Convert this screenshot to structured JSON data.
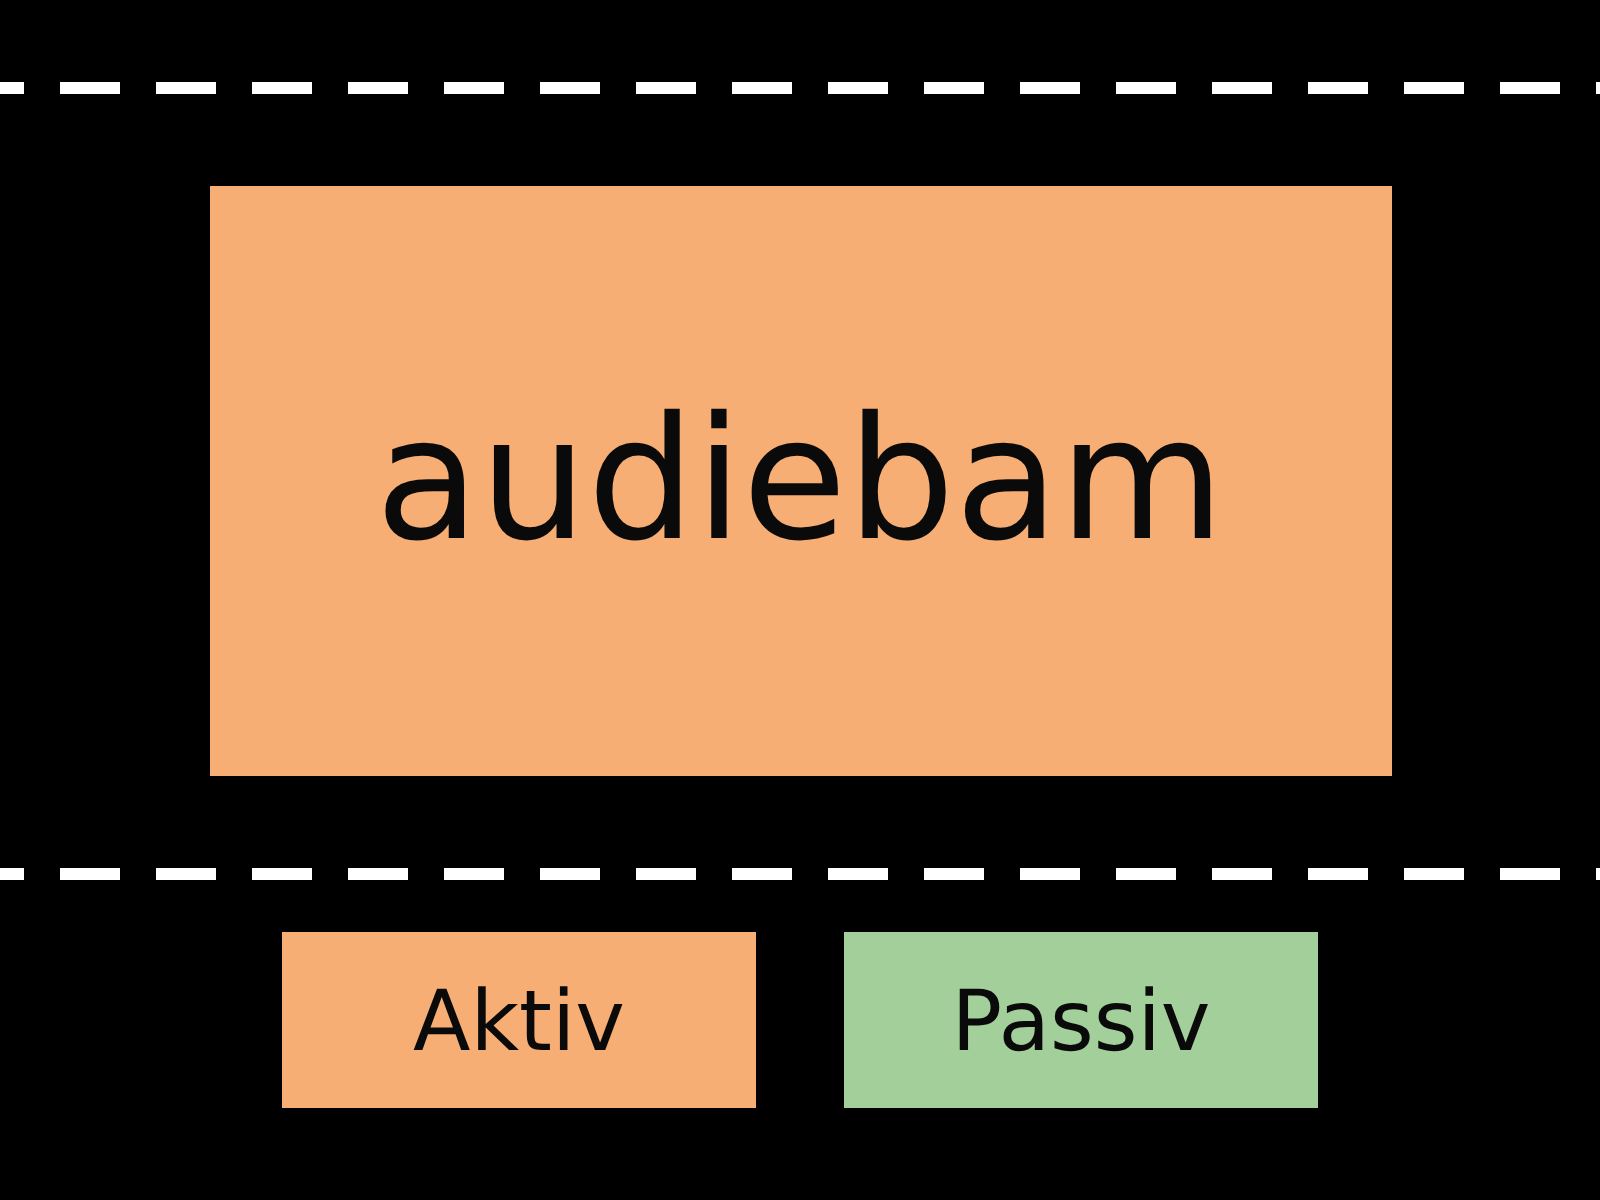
{
  "prompt": {
    "text": "audiebam"
  },
  "options": [
    {
      "label": "Aktiv",
      "color": "#f7ae74"
    },
    {
      "label": "Passiv",
      "color": "#a3d09a"
    }
  ]
}
